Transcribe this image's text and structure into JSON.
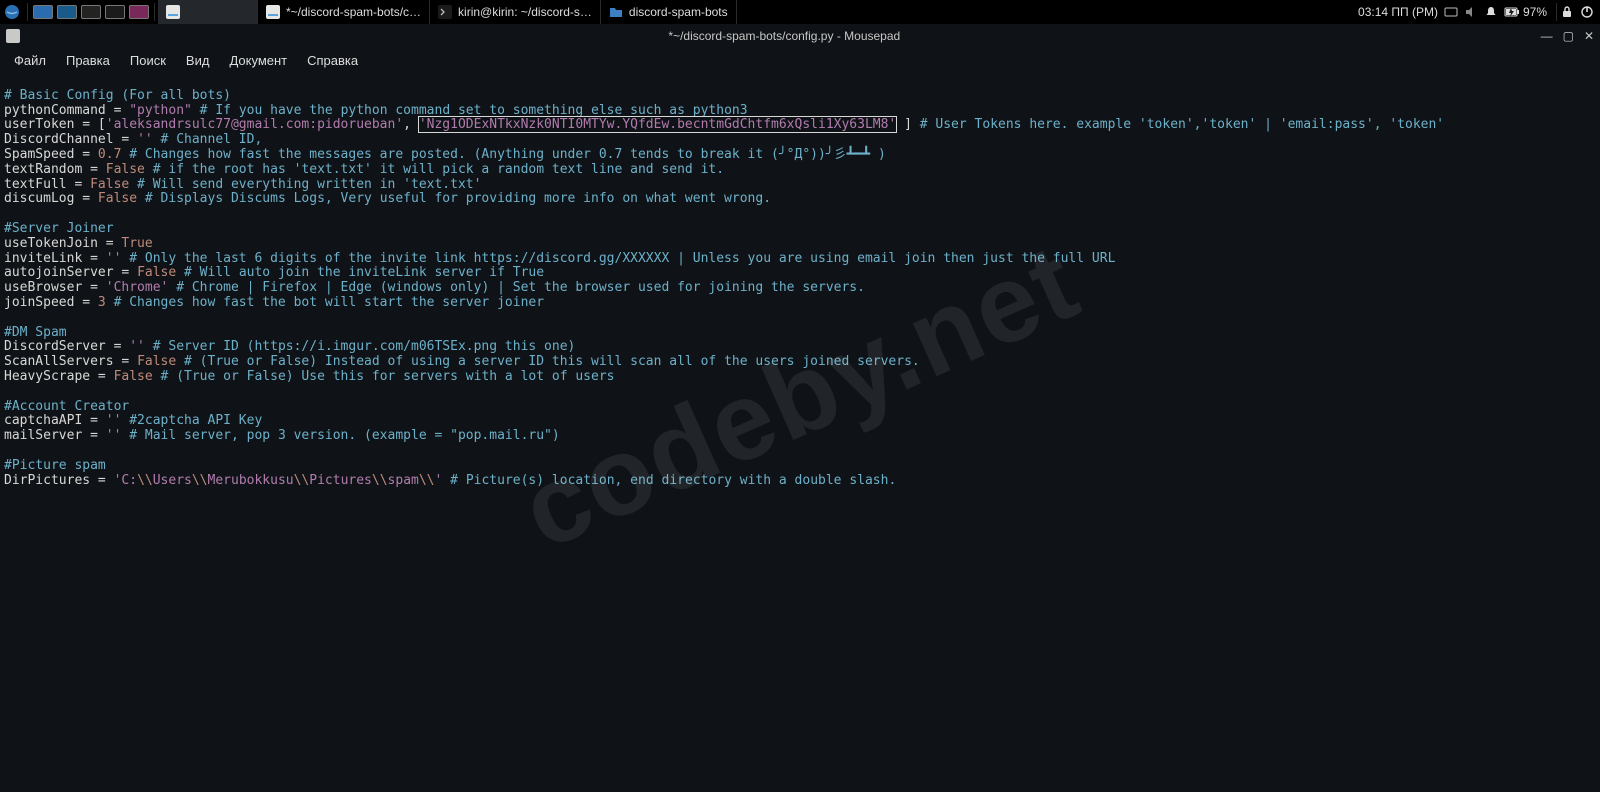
{
  "panel": {
    "task1": "*~/discord-spam-bots/c…",
    "task2": "kirin@kirin: ~/discord-s…",
    "task3": "discord-spam-bots",
    "clock": "03:14 ПП (PM)",
    "battery": "97%"
  },
  "window": {
    "title": "*~/discord-spam-bots/config.py - Mousepad"
  },
  "menu": {
    "file": "Файл",
    "edit": "Правка",
    "search": "Поиск",
    "view": "Вид",
    "document": "Документ",
    "help": "Справка"
  },
  "code": {
    "l1": "# Basic Config (For all bots)",
    "l2a": "pythonCommand = ",
    "l2b": "\"python\"",
    "l2c": " # If you have the python command set to something else such as python3",
    "l3a": "userToken = [",
    "l3b": "'aleksandrsulc77@gmail.com:pidorueban'",
    "l3c": ", ",
    "l3d": "'Nzg1ODExNTkxNzk0NTI0MTYw.YQfdEw.becntmGdChtfm6xQsli1Xy63LM8'",
    "l3e": " ] ",
    "l3f": "# User Tokens here. example 'token','token' | 'email:pass', 'token'",
    "l4a": "DiscordChannel = ",
    "l4b": "''",
    "l4c": " # Channel ID,",
    "l5a": "SpamSpeed = ",
    "l5b": "0.7",
    "l5c": " # Changes how fast the messages are posted. (Anything under 0.7 tends to break it (╯°Д°))╯彡┻━┻ )",
    "l6a": "textRandom = ",
    "l6b": "False",
    "l6c": " # if the root has 'text.txt' it will pick a random text line and send it.",
    "l7a": "textFull = ",
    "l7b": "False",
    "l7c": " # Will send everything written in 'text.txt'",
    "l8a": "discumLog = ",
    "l8b": "False",
    "l8c": " # Displays Discums Logs, Very useful for providing more info on what went wrong.",
    "l10": "#Server Joiner",
    "l11a": "useTokenJoin = ",
    "l11b": "True",
    "l12a": "inviteLink = ",
    "l12b": "''",
    "l12c": " # Only the last 6 digits of the invite link https://discord.gg/XXXXXX | Unless you are using email join then just the full URL",
    "l13a": "autojoinServer = ",
    "l13b": "False",
    "l13c": " # Will auto join the inviteLink server if True",
    "l14a": "useBrowser = ",
    "l14b": "'Chrome'",
    "l14c": " # Chrome | Firefox | Edge (windows only) | Set the browser used for joining the servers.",
    "l15a": "joinSpeed = ",
    "l15b": "3",
    "l15c": " # Changes how fast the bot will start the server joiner",
    "l17": "#DM Spam",
    "l18a": "DiscordServer = ",
    "l18b": "''",
    "l18c": " # Server ID (https://i.imgur.com/m06TSEx.png this one)",
    "l19a": "ScanAllServers = ",
    "l19b": "False",
    "l19c": " # (True or False) Instead of using a server ID this will scan all of the users joined servers.",
    "l20a": "HeavyScrape = ",
    "l20b": "False",
    "l20c": " # (True or False) Use this for servers with a lot of users",
    "l22": "#Account Creator",
    "l23a": "captchaAPI = ",
    "l23b": "''",
    "l23c": " #2captcha API Key",
    "l24a": "mailServer = ",
    "l24b": "''",
    "l24c": " # Mail server, pop 3 version. (example = \"pop.mail.ru\")",
    "l26": "#Picture spam",
    "l27a": "DirPictures = ",
    "l27b": "'C:",
    "l27c": "\\\\",
    "l27d": "Users",
    "l27e": "\\\\",
    "l27f": "Merubokkusu",
    "l27g": "\\\\",
    "l27h": "Pictures",
    "l27i": "\\\\",
    "l27j": "spam",
    "l27k": "\\\\",
    "l27l": "'",
    "l27m": " # Picture(s) location, end directory with a double slash."
  },
  "watermark": "codeby.net"
}
